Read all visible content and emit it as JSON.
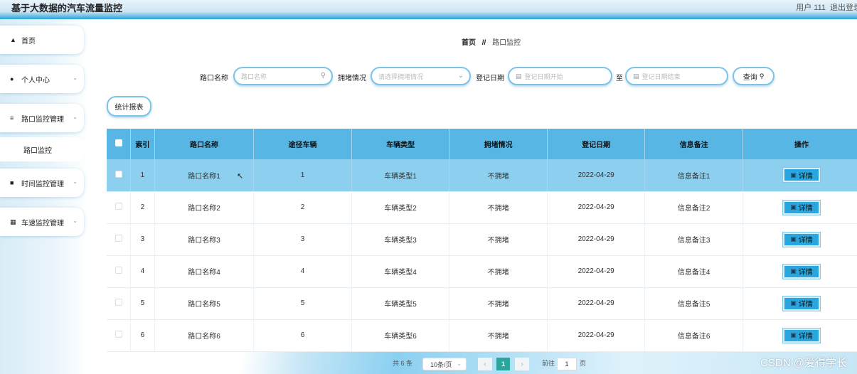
{
  "header": {
    "title": "基于大数据的汽车流量监控",
    "user_label": "用户 111",
    "logout_label": "退出登录"
  },
  "sidebar": {
    "items": [
      {
        "label": "首页",
        "icon": "home-icon"
      },
      {
        "label": "个人中心",
        "icon": "user-icon"
      },
      {
        "label": "路口监控管理",
        "icon": "menu-icon"
      },
      {
        "label": "路口监控",
        "icon": ""
      },
      {
        "label": "时间监控管理",
        "icon": "chat-icon"
      },
      {
        "label": "车速监控管理",
        "icon": "grid-icon"
      }
    ]
  },
  "breadcrumb": {
    "home": "首页",
    "sep": "//",
    "current": "路口监控"
  },
  "search": {
    "name_label": "路口名称",
    "name_placeholder": "路口名称",
    "jam_label": "拥堵情况",
    "jam_placeholder": "请选择拥堵情况",
    "date_label": "登记日期",
    "date_start_placeholder": "登记日期开始",
    "to_label": "至",
    "date_end_placeholder": "登记日期结束",
    "query_label": "查询"
  },
  "toolbar": {
    "report_label": "统计报表"
  },
  "table": {
    "headers": [
      "索引",
      "路口名称",
      "途径车辆",
      "车辆类型",
      "拥堵情况",
      "登记日期",
      "信息备注",
      "操作"
    ],
    "detail_label": "详情",
    "rows": [
      [
        "1",
        "路口名称1",
        "1",
        "车辆类型1",
        "不拥堵",
        "2022-04-29",
        "信息备注1"
      ],
      [
        "2",
        "路口名称2",
        "2",
        "车辆类型2",
        "不拥堵",
        "2022-04-29",
        "信息备注2"
      ],
      [
        "3",
        "路口名称3",
        "3",
        "车辆类型3",
        "不拥堵",
        "2022-04-29",
        "信息备注3"
      ],
      [
        "4",
        "路口名称4",
        "4",
        "车辆类型4",
        "不拥堵",
        "2022-04-29",
        "信息备注4"
      ],
      [
        "5",
        "路口名称5",
        "5",
        "车辆类型5",
        "不拥堵",
        "2022-04-29",
        "信息备注5"
      ],
      [
        "6",
        "路口名称6",
        "6",
        "车辆类型6",
        "不拥堵",
        "2022-04-29",
        "信息备注6"
      ]
    ]
  },
  "pagination": {
    "total_text": "共 6 条",
    "page_size": "10条/页",
    "current": "1",
    "goto_label": "前往",
    "goto_value": "1",
    "page_suffix": "页"
  },
  "watermark": "CSDN @爱得学长",
  "colors": {
    "header_accent": "#2aa3d9",
    "table_header": "#57b6e4",
    "selected_row": "#8ccfee",
    "detail_button": "#28a6dd",
    "pager_active": "#2aa69c"
  }
}
